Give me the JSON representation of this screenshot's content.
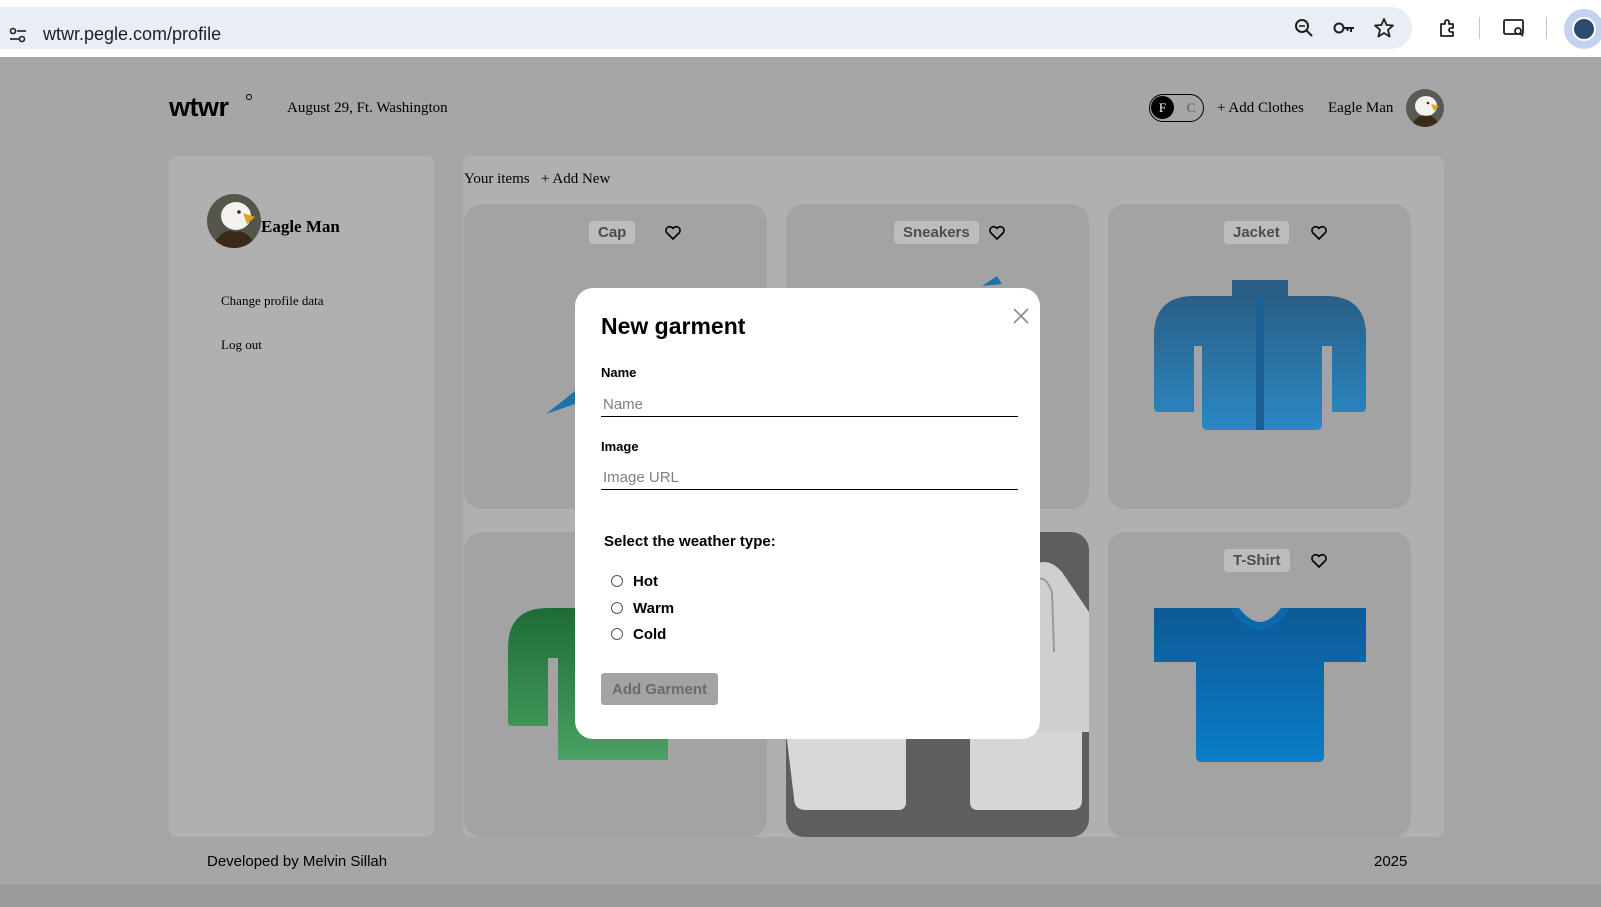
{
  "browser": {
    "url": "wtwr.pegle.com/profile",
    "icons": [
      "site-settings-icon",
      "zoom-icon",
      "key-icon",
      "star-icon",
      "extensions-icon",
      "media-router-icon",
      "profile-icon"
    ]
  },
  "header": {
    "logo": "wtwr",
    "date_location": "August 29, Ft. Washington",
    "toggle_f": "F",
    "toggle_c": "C",
    "add_clothes": "+ Add Clothes",
    "user_name": "Eagle Man"
  },
  "sidebar": {
    "user_name": "Eagle Man",
    "change_profile": "Change profile data",
    "log_out": "Log out"
  },
  "items": {
    "title": "Your items",
    "add_new": "+ Add New",
    "cards": [
      {
        "label": "Cap"
      },
      {
        "label": "Sneakers"
      },
      {
        "label": "Jacket"
      },
      {
        "label": "T-Shirt"
      }
    ]
  },
  "modal": {
    "title": "New garment",
    "name_label": "Name",
    "name_placeholder": "Name",
    "image_label": "Image",
    "image_placeholder": "Image URL",
    "weather_title": "Select the weather type:",
    "options": [
      "Hot",
      "Warm",
      "Cold"
    ],
    "submit": "Add Garment"
  },
  "footer": {
    "developer": "Developed by Melvin Sillah",
    "year": "2025"
  },
  "colors": {
    "overlay": "#a6a6a6",
    "card": "#a3a3a3",
    "jacket_blue": "#2a7fb6",
    "shirt_blue": "#0a75c2",
    "green": "#2e8b44"
  }
}
